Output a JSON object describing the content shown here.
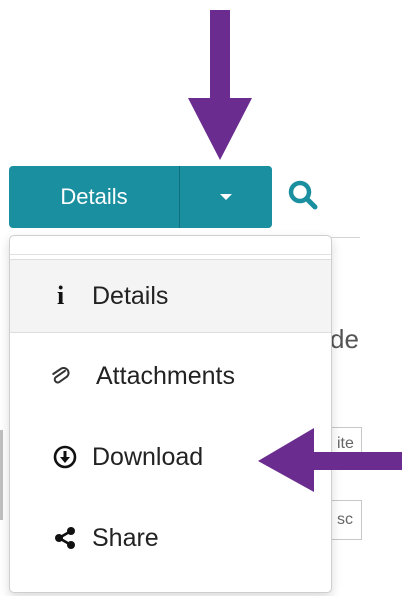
{
  "button": {
    "label": "Details"
  },
  "menu": {
    "items": [
      {
        "label": "Details",
        "icon": "info-icon"
      },
      {
        "label": "Attachments",
        "icon": "paperclip-icon"
      },
      {
        "label": "Download",
        "icon": "download-circle-icon"
      },
      {
        "label": "Share",
        "icon": "share-icon"
      }
    ]
  },
  "background": {
    "partial_text": "de",
    "cell_1": "ite",
    "cell_2": "sc"
  },
  "colors": {
    "button": "#1a8fa0",
    "arrow": "#6a2c8e",
    "search_icon": "#1a8fa0"
  }
}
